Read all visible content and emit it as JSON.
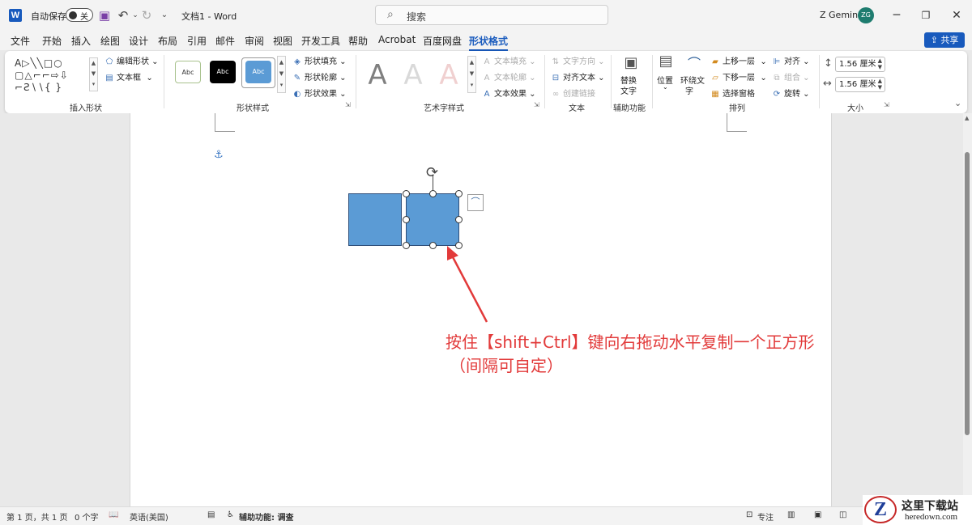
{
  "titlebar": {
    "logo": "W",
    "autosave_label": "自动保存",
    "autosave_state": "关",
    "doc_title": "文档1 - Word",
    "search_placeholder": "搜索",
    "user_name": "Z Gemini",
    "user_initials": "ZG",
    "icons": [
      "save-icon",
      "undo-icon",
      "redo-icon",
      "customize-icon"
    ]
  },
  "menu": {
    "tabs": [
      "文件",
      "开始",
      "插入",
      "绘图",
      "设计",
      "布局",
      "引用",
      "邮件",
      "审阅",
      "视图",
      "开发工具",
      "帮助",
      "Acrobat",
      "百度网盘",
      "形状格式"
    ],
    "active_tab": "形状格式",
    "share_label": "共享"
  },
  "ribbon": {
    "insert_shapes": {
      "label": "插入形状",
      "edit_shape": "编辑形状",
      "text_box": "文本框",
      "shape_rows": [
        "A▷╲╲□○",
        "▢△⌐⌐⇨⇩",
        "⌐Ƨ∖∖{ }"
      ]
    },
    "shape_styles": {
      "label": "形状样式",
      "thumb_text": "Abc",
      "fill": "形状填充",
      "outline": "形状轮廓",
      "effects": "形状效果"
    },
    "wordart": {
      "label": "艺术字样式",
      "sample": "A",
      "text_fill": "文本填充",
      "text_outline": "文本轮廓",
      "text_effects": "文本效果"
    },
    "text": {
      "label": "文本",
      "direction": "文字方向",
      "align": "对齐文本",
      "link": "创建链接"
    },
    "accessibility": {
      "label": "辅助功能",
      "alt_text_line1": "替换",
      "alt_text_line2": "文字"
    },
    "arrange": {
      "label": "排列",
      "position": "位置",
      "wrap_line1": "环绕文",
      "wrap_line2": "字",
      "bring_forward": "上移一层",
      "send_backward": "下移一层",
      "selection_pane": "选择窗格",
      "align": "对齐",
      "group": "组合",
      "rotate": "旋转"
    },
    "size": {
      "label": "大小",
      "height": "1.56 厘米",
      "width": "1.56 厘米"
    }
  },
  "annotation": {
    "line1": "按住【shift+Ctrl】键向右拖动水平复制一个正方形",
    "line2": "（间隔可自定）"
  },
  "statusbar": {
    "page": "第 1 页，共 1 页",
    "words": "0 个字",
    "language": "英语(美国)",
    "accessibility": "辅助功能: 调查",
    "focus": "专注"
  },
  "watermark": {
    "logo_letter": "Z",
    "cn": "这里下载站",
    "en": "heredown.com"
  },
  "colors": {
    "accent": "#185abd",
    "shape_fill": "#5b9bd5",
    "annotation": "#e23a3a"
  }
}
